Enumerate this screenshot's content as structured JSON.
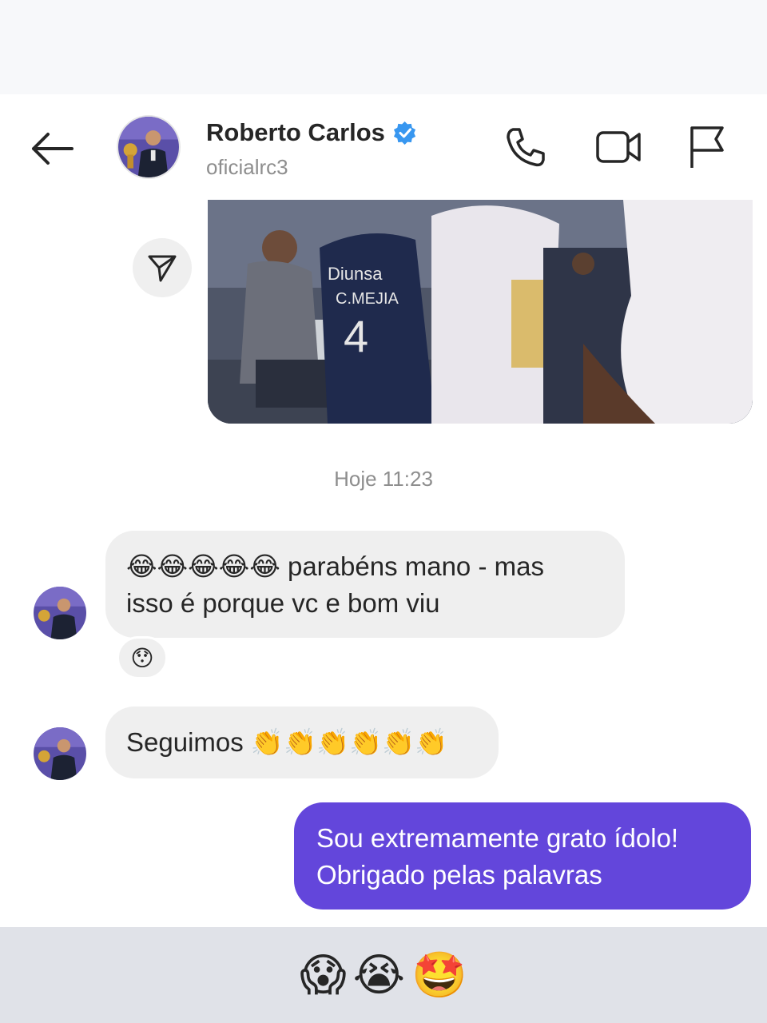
{
  "header": {
    "contact_name": "Roberto Carlos",
    "username": "oficialrc3",
    "verified": true,
    "icons": [
      "back-arrow-icon",
      "phone-icon",
      "video-camera-icon",
      "flag-icon",
      "verified-badge-icon"
    ]
  },
  "chat": {
    "shared_media_icon": "send-share-icon",
    "timestamp": "Hoje 11:23",
    "messages": [
      {
        "sender": "contact",
        "emoji_prefix": "😂😂😂😂😂",
        "text_line1": " parabéns mano - mas",
        "text_line2": "isso é porque vc e bom viu",
        "reaction": "😯"
      },
      {
        "sender": "contact",
        "text": "Seguimos ",
        "emoji_suffix": "👏👏👏👏👏👏"
      },
      {
        "sender": "me",
        "text_line1": "Sou extremamente grato ídolo!",
        "text_line2": "Obrigado pelas palavras"
      }
    ]
  },
  "overlay": {
    "emojis": [
      "😱",
      "😭",
      "🤩"
    ]
  },
  "colors": {
    "accent": "#6346db",
    "incoming_bubble": "#efefef",
    "verified": "#3897f0",
    "muted_text": "#8e8e8e"
  }
}
